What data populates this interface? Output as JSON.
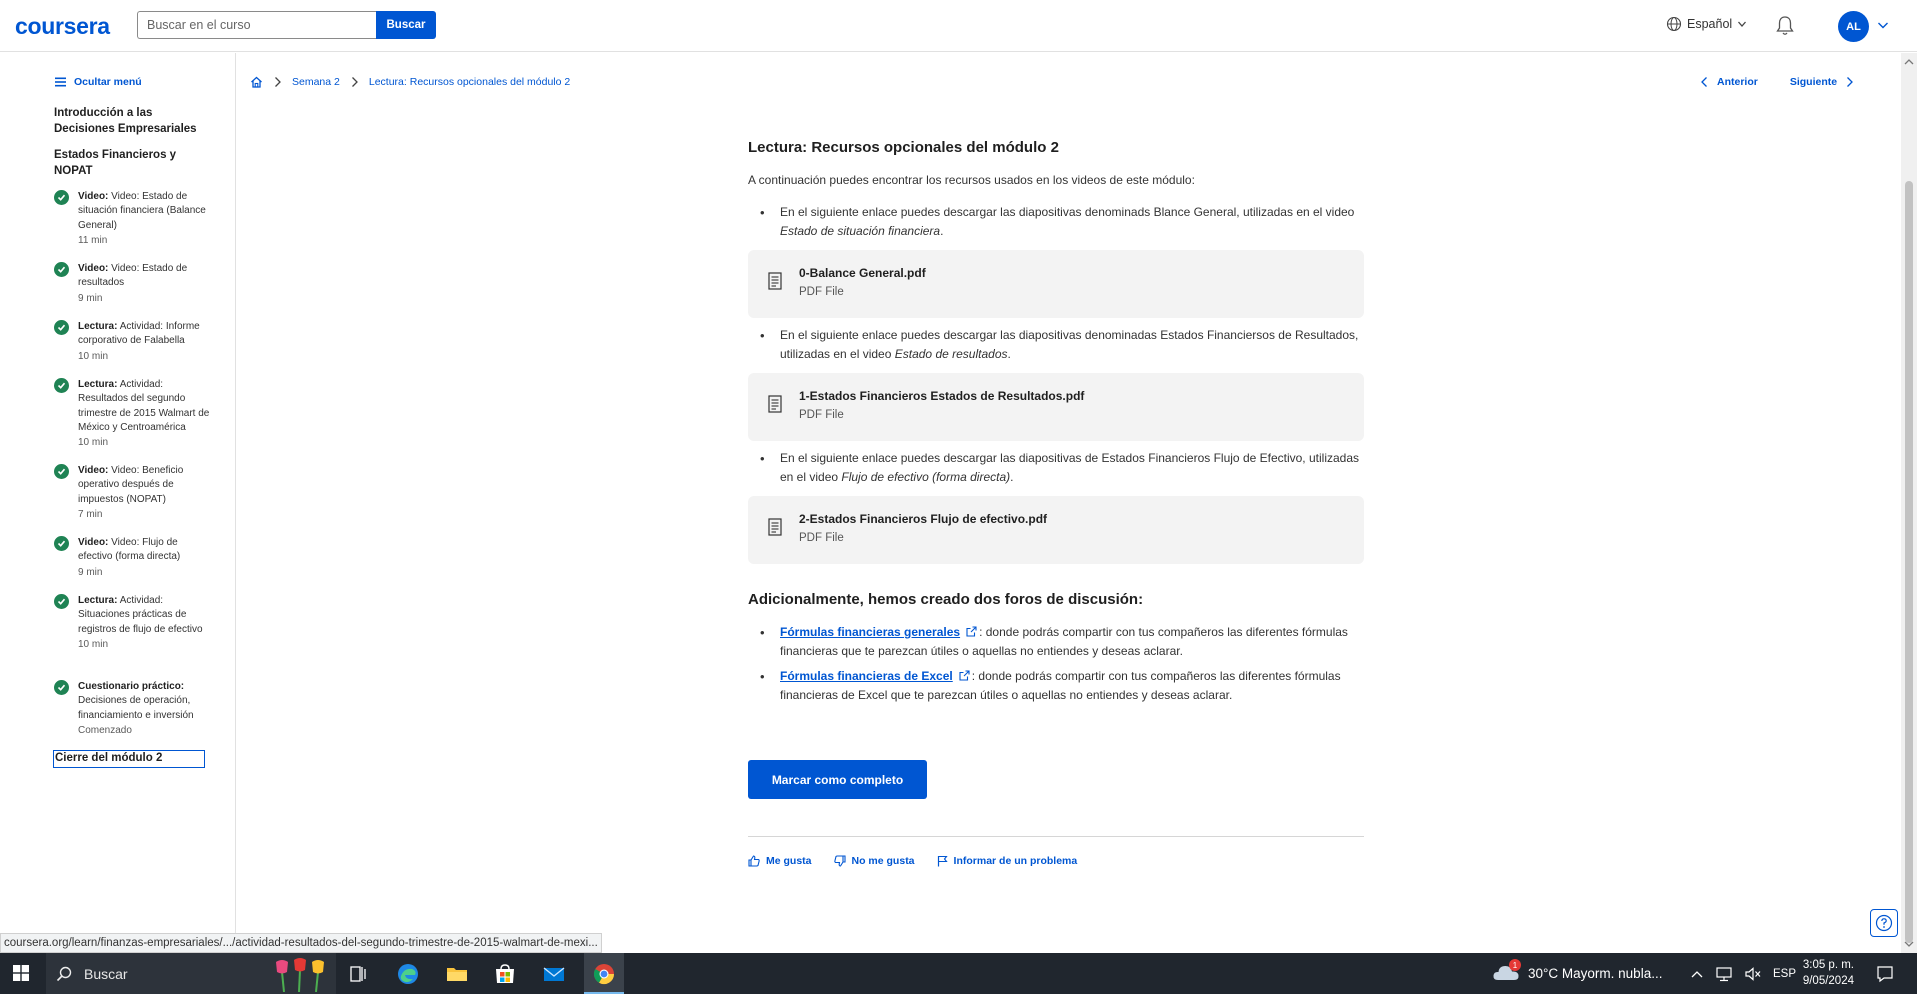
{
  "header": {
    "logo": "coursera",
    "search_placeholder": "Buscar en el curso",
    "search_button": "Buscar",
    "language": "Español",
    "avatar_initials": "AL"
  },
  "sidebar": {
    "hide_menu": "Ocultar menú",
    "section1": "Introducción a las Decisiones Empresariales",
    "section2": "Estados Financieros y NOPAT",
    "items": [
      {
        "type": "Video:",
        "title": "Video: Estado de situación financiera (Balance General)",
        "duration": "11 min"
      },
      {
        "type": "Video:",
        "title": "Video: Estado de resultados",
        "duration": "9 min"
      },
      {
        "type": "Lectura:",
        "title": "Actividad: Informe corporativo de Falabella",
        "duration": "10 min"
      },
      {
        "type": "Lectura:",
        "title": "Actividad: Resultados del segundo trimestre de 2015 Walmart de México y Centroamérica",
        "duration": "10 min"
      },
      {
        "type": "Video:",
        "title": "Video: Beneficio operativo después de impuestos (NOPAT)",
        "duration": "7 min"
      },
      {
        "type": "Video:",
        "title": "Video: Flujo de efectivo (forma directa)",
        "duration": "9 min"
      },
      {
        "type": "Lectura:",
        "title": "Actividad: Situaciones prácticas de registros de flujo de efectivo",
        "duration": "10 min"
      },
      {
        "type": "Cuestionario práctico:",
        "title": "Decisiones de operación, financiamiento e inversión",
        "duration": "Comenzado"
      }
    ],
    "current": "Cierre del módulo 2"
  },
  "breadcrumb": {
    "week": "Semana 2",
    "page": "Lectura: Recursos opcionales del módulo 2"
  },
  "nav": {
    "prev": "Anterior",
    "next": "Siguiente"
  },
  "content": {
    "title": "Lectura: Recursos opcionales del módulo 2",
    "intro": "A continuación puedes encontrar los recursos usados en los videos de este módulo:",
    "resources": [
      {
        "text": "En el siguiente enlace puedes descargar las diapositivas denominads Blance General, utilizadas en el video ",
        "video": "Estado de situación financiera",
        "suffix": ".",
        "file": "0-Balance General.pdf",
        "file_type": "PDF File"
      },
      {
        "text": "En el siguiente enlace puedes descargar las diapositivas denominadas Estados Financiersos de Resultados, utilizadas en el video ",
        "video": "Estado de resultados",
        "suffix": ".",
        "file": "1-Estados Financieros Estados de Resultados.pdf",
        "file_type": "PDF File"
      },
      {
        "text": "En el siguiente enlace puedes descargar las diapositivas  de Estados Financieros Flujo de Efectivo, utilizadas en el video ",
        "video": "Flujo de efectivo (forma directa)",
        "suffix": ".",
        "file": "2-Estados Financieros Flujo de efectivo.pdf",
        "file_type": "PDF File"
      }
    ],
    "forums_heading": "Adicionalmente, hemos creado dos foros de discusión:",
    "forums": [
      {
        "link": "Fórmulas financieras generales",
        "text": ": donde podrás compartir con tus compañeros las diferentes fórmulas financieras que te parezcan útiles o aquellas no entiendes y deseas aclarar."
      },
      {
        "link": "Fórmulas financieras de Excel",
        "text": ": donde podrás compartir con tus compañeros las diferentes fórmulas financieras de Excel que te parezcan útiles o aquellas no entiendes y deseas aclarar."
      }
    ],
    "complete_button": "Marcar como completo",
    "feedback": {
      "like": "Me gusta",
      "dislike": "No me gusta",
      "report": "Informar de un problema"
    }
  },
  "status_url": "coursera.org/learn/finanzas-empresariales/.../actividad-resultados-del-segundo-trimestre-de-2015-walmart-de-mexi...",
  "taskbar": {
    "search": "Buscar",
    "weather": "30°C  Mayorm. nubla...",
    "weather_badge": "1",
    "lang": "ESP",
    "time": "3:05 p. m.",
    "date": "9/05/2024"
  },
  "colors": {
    "brand": "#0056d2",
    "complete": "#1f8354",
    "taskbar": "#20262e"
  }
}
